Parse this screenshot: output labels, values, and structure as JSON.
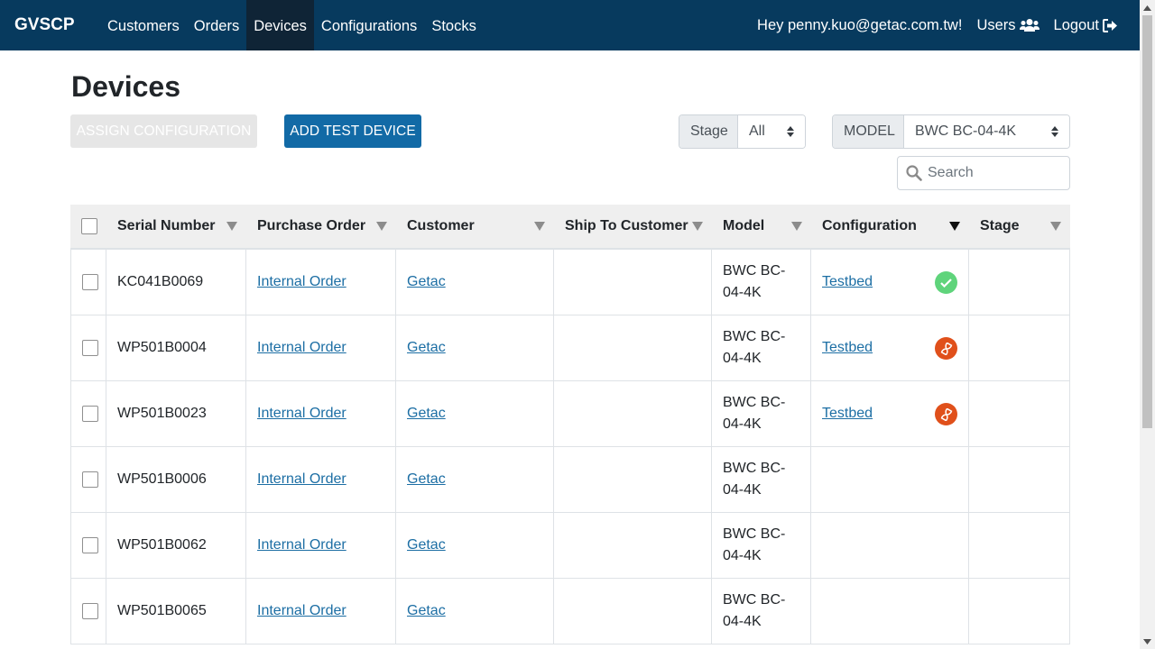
{
  "navbar": {
    "brand": "GVSCP",
    "links": [
      "Customers",
      "Orders",
      "Devices",
      "Configurations",
      "Stocks"
    ],
    "active": "Devices",
    "greeting": "Hey penny.kuo@getac.com.tw!",
    "users_label": "Users",
    "logout_label": "Logout"
  },
  "page": {
    "title": "Devices",
    "assign_button": "ASSIGN CONFIGURATION",
    "add_button": "ADD TEST DEVICE"
  },
  "filters": {
    "stage_label": "Stage",
    "stage_value": "All",
    "model_label": "MODEL",
    "model_value": "BWC BC-04-4K",
    "search_placeholder": "Search"
  },
  "table": {
    "columns": [
      "Serial Number",
      "Purchase Order",
      "Customer",
      "Ship To Customer",
      "Model",
      "Configuration",
      "Stage"
    ],
    "rows": [
      {
        "serial": "KC041B0069",
        "po": "Internal Order",
        "customer": "Getac",
        "ship_to": "",
        "model": "BWC BC-04-4K",
        "config": "Testbed",
        "status": "check-icon",
        "stage": ""
      },
      {
        "serial": "WP501B0004",
        "po": "Internal Order",
        "customer": "Getac",
        "ship_to": "",
        "model": "BWC BC-04-4K",
        "config": "Testbed",
        "status": "hourglass-icon",
        "stage": ""
      },
      {
        "serial": "WP501B0023",
        "po": "Internal Order",
        "customer": "Getac",
        "ship_to": "",
        "model": "BWC BC-04-4K",
        "config": "Testbed",
        "status": "hourglass-icon",
        "stage": ""
      },
      {
        "serial": "WP501B0006",
        "po": "Internal Order",
        "customer": "Getac",
        "ship_to": "",
        "model": "BWC BC-04-4K",
        "config": "",
        "status": "",
        "stage": ""
      },
      {
        "serial": "WP501B0062",
        "po": "Internal Order",
        "customer": "Getac",
        "ship_to": "",
        "model": "BWC BC-04-4K",
        "config": "",
        "status": "",
        "stage": ""
      },
      {
        "serial": "WP501B0065",
        "po": "Internal Order",
        "customer": "Getac",
        "ship_to": "",
        "model": "BWC BC-04-4K",
        "config": "",
        "status": "",
        "stage": ""
      }
    ]
  },
  "colors": {
    "navbar": "#073a5e",
    "primary_button": "#126aa6",
    "success": "#5fd47b",
    "pending": "#e0501b",
    "link": "#1c6ea4"
  }
}
